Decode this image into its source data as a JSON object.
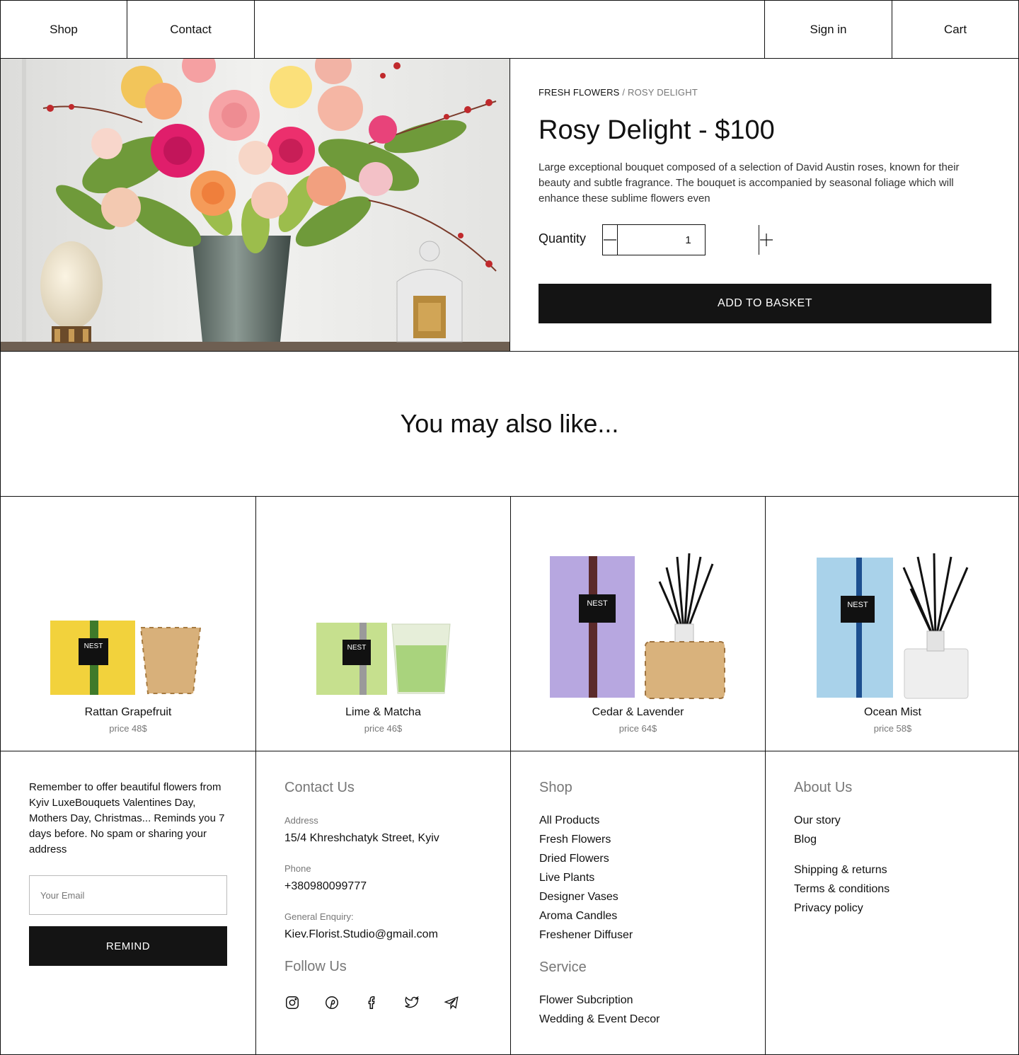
{
  "nav": {
    "shop": "Shop",
    "contact": "Contact",
    "sign_in": "Sign in",
    "cart": "Cart"
  },
  "product": {
    "breadcrumb": [
      "FRESH FLOWERS",
      "ROSY DELIGHT"
    ],
    "breadcrumb_separator": "/",
    "title": "Rosy Delight - $100",
    "description": "Large exceptional bouquet composed of a selection of David Austin roses, known for their beauty and subtle fragrance. The bouquet is accompanied by seasonal foliage which will enhance these sublime flowers even",
    "quantity_label": "Quantity",
    "quantity": "1",
    "add_to_basket": "ADD TO BASKET"
  },
  "recommendations": {
    "heading": "You may also like...",
    "items": [
      {
        "name": "Rattan Grapefruit",
        "price": "price 48$",
        "box_color": "#f2d23c",
        "stripe_color": "#3f7a2a",
        "brand": "NEST"
      },
      {
        "name": "Lime & Matcha",
        "price": "price 46$",
        "box_color": "#c6e08e",
        "stripe_color": "#9a9a9a",
        "brand": "NEST"
      },
      {
        "name": "Cedar & Lavender",
        "price": "price 64$",
        "box_color": "#b7a7e0",
        "stripe_color": "#5b2a2a",
        "brand": "NEST"
      },
      {
        "name": "Ocean Mist",
        "price": "price 58$",
        "box_color": "#a9d2ea",
        "stripe_color": "#1d4f8f",
        "brand": "NEST"
      }
    ]
  },
  "footer": {
    "remind_text": "Remember to offer beautiful flowers from Kyiv LuxeBouquets Valentines Day, Mothers Day, Christmas... Reminds you 7 days before. No spam or sharing your address",
    "email_placeholder": "Your Email",
    "remind_button": "REMIND",
    "contact": {
      "heading": "Contact Us",
      "address_label": "Address",
      "address": "15/4 Khreshchatyk Street, Kyiv",
      "phone_label": "Phone",
      "phone": "+380980099777",
      "enquiry_label": "General Enquiry:",
      "email": "Kiev.Florist.Studio@gmail.com",
      "follow_heading": "Follow Us"
    },
    "shop": {
      "heading": "Shop",
      "links": [
        "All Products",
        "Fresh Flowers",
        "Dried Flowers",
        "Live Plants",
        "Designer Vases",
        "Aroma Candles",
        "Freshener Diffuser"
      ],
      "service_heading": "Service",
      "service_links": [
        "Flower Subcription",
        "Wedding & Event Decor"
      ]
    },
    "about": {
      "heading": "About Us",
      "links": [
        "Our story",
        "Blog"
      ],
      "policy_links": [
        "Shipping & returns",
        "Terms & conditions",
        "Privacy policy"
      ]
    },
    "social_icons": [
      "instagram-icon",
      "pinterest-icon",
      "facebook-icon",
      "twitter-icon",
      "telegram-icon"
    ]
  }
}
